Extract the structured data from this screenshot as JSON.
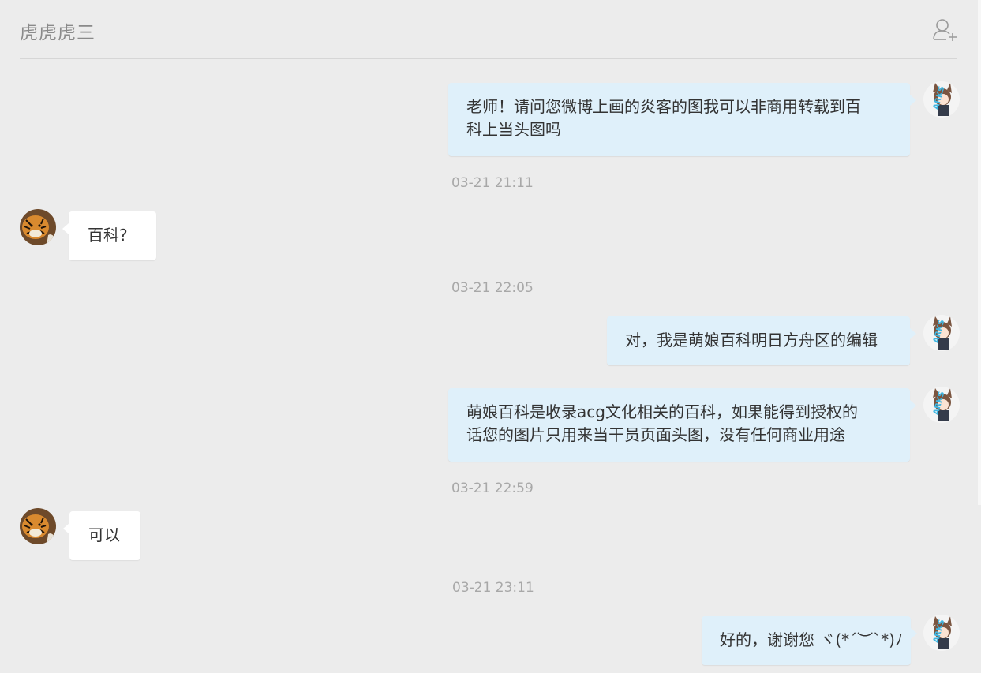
{
  "header": {
    "title": "虎虎虎三",
    "add_contact_icon": "add-user-icon"
  },
  "messages": [
    {
      "from": "me",
      "text": "老师！请问您微博上画的炎客的图我可以非商用转载到百科上当头图吗",
      "line1": "老师！请问您微博上画的炎客的图我可以非商用转载到百",
      "line2": "科上当头图吗"
    },
    {
      "from": "them",
      "text": "百科?"
    },
    {
      "from": "me",
      "text": "对，我是萌娘百科明日方舟区的编辑"
    },
    {
      "from": "me",
      "text": "萌娘百科是收录acg文化相关的百科，如果能得到授权的话您的图片只用来当干员页面头图，没有任何商业用途",
      "line1": "萌娘百科是收录acg文化相关的百科，如果能得到授权的",
      "line2": "话您的图片只用来当干员页面头图，没有任何商业用途"
    },
    {
      "from": "them",
      "text": "可以"
    },
    {
      "from": "me",
      "text": "好的，谢谢您 ヾ(*´︶`*)ﾉ"
    }
  ],
  "timestamps": [
    "03-21 21:11",
    "03-21 22:05",
    "03-21 22:59",
    "03-21 23:11"
  ],
  "colors": {
    "background": "#ececec",
    "my_bubble": "#dff0fa",
    "their_bubble": "#ffffff",
    "timestamp": "#a8a8a8"
  },
  "avatars": {
    "me": "anime-character-avatar",
    "them": "tiger-avatar"
  }
}
